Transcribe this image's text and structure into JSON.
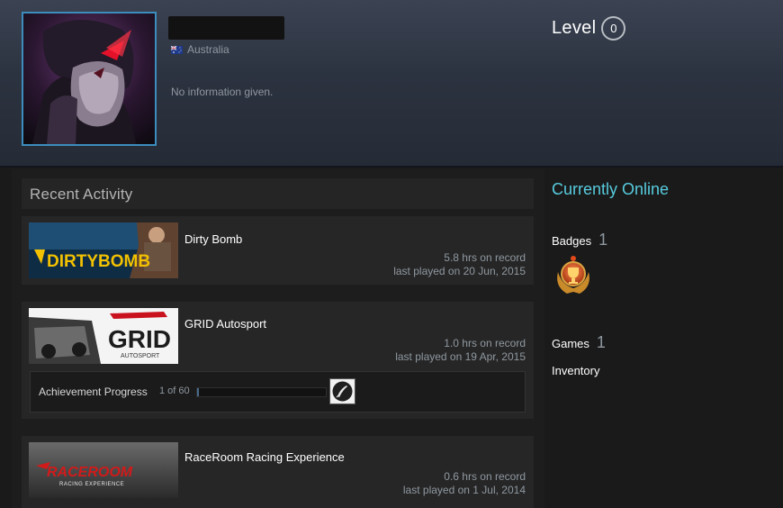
{
  "profile": {
    "country": "Australia",
    "summary": "No information given.",
    "level_label": "Level",
    "level_value": "0"
  },
  "recent_activity": {
    "title": "Recent Activity",
    "games": [
      {
        "name": "Dirty Bomb",
        "hours": "5.8 hrs on record",
        "last_played": "last played on 20 Jun, 2015",
        "thumb_text": "DIRTYBOMB"
      },
      {
        "name": "GRID Autosport",
        "hours": "1.0 hrs on record",
        "last_played": "last played on 19 Apr, 2015",
        "thumb_text": "GRID",
        "thumb_subtext": "AUTOSPORT",
        "achievement": {
          "label": "Achievement Progress",
          "count": "1 of 60",
          "progress": 0.0167
        }
      },
      {
        "name": "RaceRoom Racing Experience",
        "hours": "0.6 hrs on record",
        "last_played": "last played on 1 Jul, 2014",
        "thumb_text": "RACEROOM",
        "thumb_subtext": "RACING EXPERIENCE"
      }
    ]
  },
  "sidebar": {
    "status": "Currently Online",
    "badges_label": "Badges",
    "badges_count": "1",
    "games_label": "Games",
    "games_count": "1",
    "inventory_label": "Inventory"
  },
  "colors": {
    "accent_online": "#57cbde",
    "avatar_border": "#3c8dbd",
    "muted_text": "#8f98a0"
  }
}
